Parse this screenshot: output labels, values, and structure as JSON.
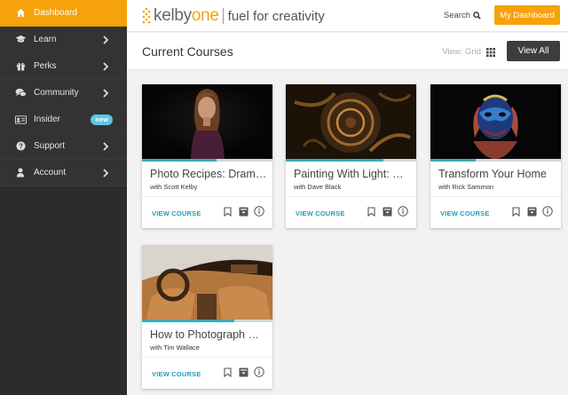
{
  "sidebar": {
    "items": [
      {
        "label": "Dashboard",
        "icon": "home-icon",
        "active": true
      },
      {
        "label": "Learn",
        "icon": "graduation-cap-icon"
      },
      {
        "label": "Perks",
        "icon": "gift-icon"
      },
      {
        "label": "Community",
        "icon": "chat-bubbles-icon"
      },
      {
        "label": "Insider",
        "icon": "id-card-icon",
        "badge": "new"
      },
      {
        "label": "Support",
        "icon": "question-circle-icon"
      },
      {
        "label": "Account",
        "icon": "user-icon"
      }
    ]
  },
  "header": {
    "logo_kelby": "kelby",
    "logo_one": "one",
    "logo_tagline": "fuel for creativity",
    "search_label": "Search",
    "dashboard_button": "My Dashboard"
  },
  "titlebar": {
    "title": "Current Courses",
    "view_label": "View: Grid",
    "view_all": "View All"
  },
  "courses": [
    {
      "title": "Photo Recipes: Dramatic Portraits",
      "author": "with Scott Kelby",
      "cta": "VIEW COURSE",
      "progress": 0.57
    },
    {
      "title": "Painting With Light: Still Life",
      "author": "with Dave Black",
      "cta": "VIEW COURSE",
      "progress": 0.75
    },
    {
      "title": "Transform Your Home",
      "author": "with Rick Sammon",
      "cta": "VIEW COURSE",
      "progress": 0.35
    },
    {
      "title": "How to Photograph Cars",
      "author": "with Tim Wallace",
      "cta": "VIEW COURSE",
      "progress": 0.71
    }
  ],
  "colors": {
    "accent": "#f5a20c",
    "sidebar": "#333333",
    "teal": "#3aabb6",
    "link": "#1f9fb5"
  }
}
